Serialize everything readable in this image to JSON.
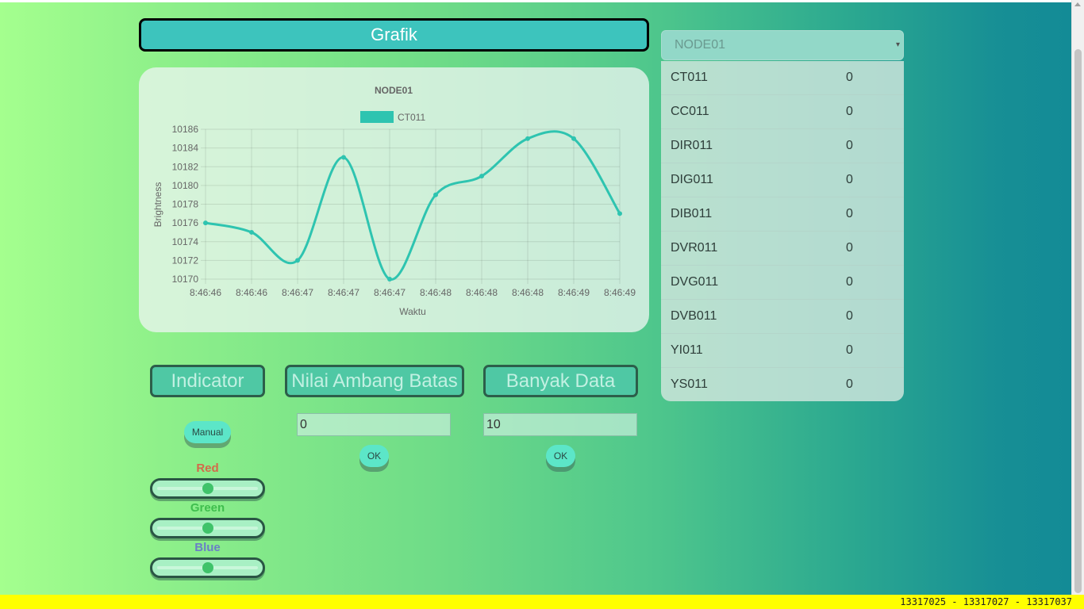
{
  "header": {
    "title": "Grafik"
  },
  "chart_data": {
    "type": "line",
    "title": "NODE01",
    "xlabel": "Waktu",
    "ylabel": "Brightness",
    "categories": [
      "8:46:46",
      "8:46:46",
      "8:46:47",
      "8:46:47",
      "8:46:47",
      "8:46:48",
      "8:46:48",
      "8:46:48",
      "8:46:49",
      "8:46:49"
    ],
    "series": [
      {
        "name": "CT011",
        "values": [
          10176,
          10175,
          10172,
          10183,
          10170,
          10179,
          10181,
          10185,
          10185,
          10177
        ]
      }
    ],
    "ylim": [
      10170,
      10186
    ],
    "yticks": [
      "10186",
      "10184",
      "10182",
      "10180",
      "10178",
      "10176",
      "10174",
      "10172",
      "10170"
    ],
    "legend_position": "top",
    "grid": true,
    "line_color": "#2ec4b0"
  },
  "controls": {
    "indicator_label": "Indicator",
    "threshold_label": "Nilai Ambang Batas",
    "data_count_label": "Banyak Data",
    "manual_label": "Manual",
    "threshold_value": "0",
    "data_count_value": "10",
    "ok_label": "OK",
    "red_label": "Red",
    "green_label": "Green",
    "blue_label": "Blue",
    "red_level": 0.5,
    "green_level": 0.5,
    "blue_level": 0.5,
    "red_color": "#d36a4a",
    "green_color": "#3fbe4e",
    "blue_color": "#6a7fc6"
  },
  "node_panel": {
    "selected": "NODE01",
    "rows": [
      {
        "name": "CT011",
        "value": "0"
      },
      {
        "name": "CC011",
        "value": "0"
      },
      {
        "name": "DIR011",
        "value": "0"
      },
      {
        "name": "DIG011",
        "value": "0"
      },
      {
        "name": "DIB011",
        "value": "0"
      },
      {
        "name": "DVR011",
        "value": "0"
      },
      {
        "name": "DVG011",
        "value": "0"
      },
      {
        "name": "DVB011",
        "value": "0"
      },
      {
        "name": "YI011",
        "value": "0"
      },
      {
        "name": "YS011",
        "value": "0"
      }
    ]
  },
  "status": {
    "text": "13317025 - 13317027 - 13317037"
  }
}
